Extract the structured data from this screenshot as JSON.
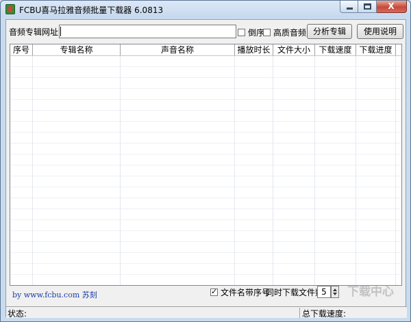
{
  "window": {
    "title": "FCBU喜马拉雅音频批量下载器 6.0813",
    "close_glyph": "X",
    "icons": [
      "app-icon",
      "minimize-icon",
      "maximize-icon",
      "close-icon"
    ]
  },
  "toolbar": {
    "url_label": "音频专辑网址:",
    "url_value": "",
    "url_placeholder": "",
    "reverse_label": "倒序",
    "reverse_checked": false,
    "hq_label": "高质音频",
    "hq_checked": false,
    "analyze_label": "分析专辑",
    "help_label": "使用说明"
  },
  "table": {
    "columns": [
      "序号",
      "专辑名称",
      "声音名称",
      "播放时长",
      "文件大小",
      "下载速度",
      "下载进度"
    ],
    "rows": []
  },
  "footer": {
    "credit": "by www.fcbu.com 苏刻",
    "seq_label": "文件名带序号",
    "seq_checked": true,
    "concurrent_label": "同时下载文件数:",
    "concurrent_value": "5"
  },
  "statusbar": {
    "status_label": "状态:",
    "speed_label": "总下载速度:"
  },
  "watermark": "下载中心"
}
